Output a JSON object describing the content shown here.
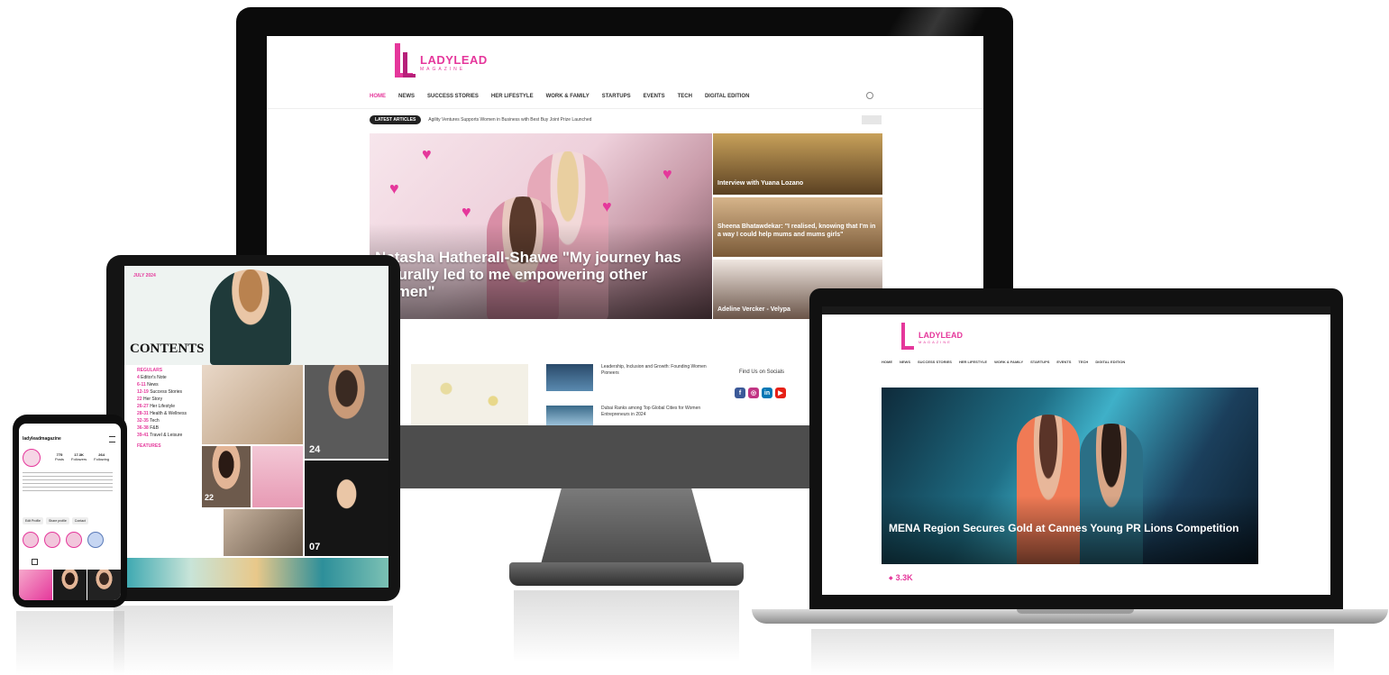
{
  "colors": {
    "brand_pink": "#e5379b",
    "dark_pink": "#b71f79",
    "bezel": "#0b0b0b"
  },
  "monitor": {
    "logo": {
      "name": "LADYLEAD",
      "sub": "MAGAZINE"
    },
    "nav": [
      "HOME",
      "NEWS",
      "SUCCESS STORIES",
      "HER LIFESTYLE",
      "WORK & FAMILY",
      "STARTUPS",
      "EVENTS",
      "TECH",
      "DIGITAL EDITION"
    ],
    "ticker": {
      "badge": "LATEST ARTICLES",
      "text": "Agility Ventures Supports Women in Business with Best Buy Joint Prize Launched"
    },
    "hero": {
      "title": "Natasha Hatherall-Shawe \"My journey has naturally led to me empowering other women\""
    },
    "side_cards": [
      {
        "title": "Interview with Yuana Lozano"
      },
      {
        "title": "Sheena Bhatawdekar: \"I realised, knowing that I'm in a way I could help mums and mums girls\""
      },
      {
        "title": "Adeline Vercker - Velypa"
      }
    ],
    "list_items": [
      {
        "text": "Leadership, Inclusion and Growth: Founding Women Pioneers"
      },
      {
        "text": "Dubai Ranks among Top Global Cities for Women Entrepreneurs in 2024"
      }
    ],
    "find_us": "Find Us on Socials",
    "socials": [
      "f",
      "◎",
      "in",
      "▶"
    ]
  },
  "laptop": {
    "logo": {
      "name": "LADYLEAD",
      "sub": "MAGAZINE"
    },
    "nav": [
      "HOME",
      "NEWS",
      "SUCCESS STORIES",
      "HER LIFESTYLE",
      "WORK & FAMILY",
      "STARTUPS",
      "EVENTS",
      "TECH",
      "DIGITAL EDITION"
    ],
    "hero_title": "MENA Region Secures Gold at Cannes Young PR Lions Competition",
    "shares": "3.3K"
  },
  "tablet": {
    "issue": "JULY 2024",
    "heading": "CONTENTS",
    "toc": [
      {
        "num": "REGULARS",
        "label": ""
      },
      {
        "num": "4",
        "label": "Editor's Note"
      },
      {
        "num": "6-11",
        "label": "News"
      },
      {
        "num": "12-19",
        "label": "Success Stories"
      },
      {
        "num": "22",
        "label": "Her Story"
      },
      {
        "num": "26-27",
        "label": "Her Lifestyle"
      },
      {
        "num": "28-31",
        "label": "Health & Wellness"
      },
      {
        "num": "32-35",
        "label": "Tech"
      },
      {
        "num": "36-38",
        "label": "F&B"
      },
      {
        "num": "39-41",
        "label": "Travel & Leisure"
      },
      {
        "num": "FEATURES",
        "label": ""
      }
    ],
    "page_numbers": [
      "22",
      "24",
      "07"
    ]
  },
  "phone": {
    "handle": "ladyleadmagazine",
    "stats": [
      {
        "value": "775",
        "label": "Posts"
      },
      {
        "value": "17.3K",
        "label": "Followers"
      },
      {
        "value": "264",
        "label": "Following"
      }
    ],
    "buttons": [
      "Edit Profile",
      "Share profile",
      "Contact"
    ]
  }
}
